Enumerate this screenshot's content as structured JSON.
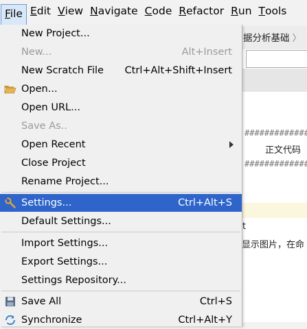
{
  "menubar": {
    "items": [
      {
        "label": "File",
        "mnemonic": "F",
        "rest": "ile"
      },
      {
        "label": "Edit",
        "mnemonic": "E",
        "rest": "dit"
      },
      {
        "label": "View",
        "mnemonic": "V",
        "rest": "iew"
      },
      {
        "label": "Navigate",
        "mnemonic": "N",
        "rest": "avigate"
      },
      {
        "label": "Code",
        "mnemonic": "C",
        "rest": "ode"
      },
      {
        "label": "Refactor",
        "mnemonic": "R",
        "rest": "efactor"
      },
      {
        "label": "Run",
        "mnemonic": "R",
        "rest": "un"
      },
      {
        "label": "Tools",
        "mnemonic": "T",
        "rest": "ools"
      }
    ]
  },
  "background": {
    "breadcrumb": "据分析基础",
    "breadcrumb_sep": "〉",
    "hash_line_1": "##############",
    "hash_line_2": "##############",
    "code_text": "正文代码",
    "letter_t": "t",
    "cn_text": "显示图片，在命"
  },
  "file_menu": {
    "items": [
      {
        "label": "New Project...",
        "shortcut": "",
        "state": "normal"
      },
      {
        "label": "New...",
        "shortcut": "Alt+Insert",
        "state": "disabled"
      },
      {
        "label": "New Scratch File",
        "shortcut": "Ctrl+Alt+Shift+Insert",
        "state": "normal"
      },
      {
        "label": "Open...",
        "shortcut": "",
        "state": "normal",
        "icon": "folder-open-icon"
      },
      {
        "label": "Open URL...",
        "shortcut": "",
        "state": "normal"
      },
      {
        "label": "Save As..",
        "shortcut": "",
        "state": "disabled"
      },
      {
        "label": "Open Recent",
        "shortcut": "",
        "state": "normal",
        "submenu": true
      },
      {
        "label": "Close Project",
        "shortcut": "",
        "state": "normal"
      },
      {
        "label": "Rename Project...",
        "shortcut": "",
        "state": "normal"
      },
      {
        "label": "Settings...",
        "shortcut": "Ctrl+Alt+S",
        "state": "selected",
        "icon": "settings-wrench-icon"
      },
      {
        "label": "Default Settings...",
        "shortcut": "",
        "state": "normal"
      },
      {
        "label": "Import Settings...",
        "shortcut": "",
        "state": "normal"
      },
      {
        "label": "Export Settings...",
        "shortcut": "",
        "state": "normal"
      },
      {
        "label": "Settings Repository...",
        "shortcut": "",
        "state": "normal"
      },
      {
        "label": "Save All",
        "shortcut": "Ctrl+S",
        "state": "normal",
        "icon": "save-all-icon"
      },
      {
        "label": "Synchronize",
        "shortcut": "Ctrl+Alt+Y",
        "state": "normal",
        "icon": "synchronize-icon"
      }
    ]
  },
  "colors": {
    "selection": "#2f65ca",
    "menu_bg": "#f0f0f0",
    "disabled_text": "#9a9a9a"
  }
}
